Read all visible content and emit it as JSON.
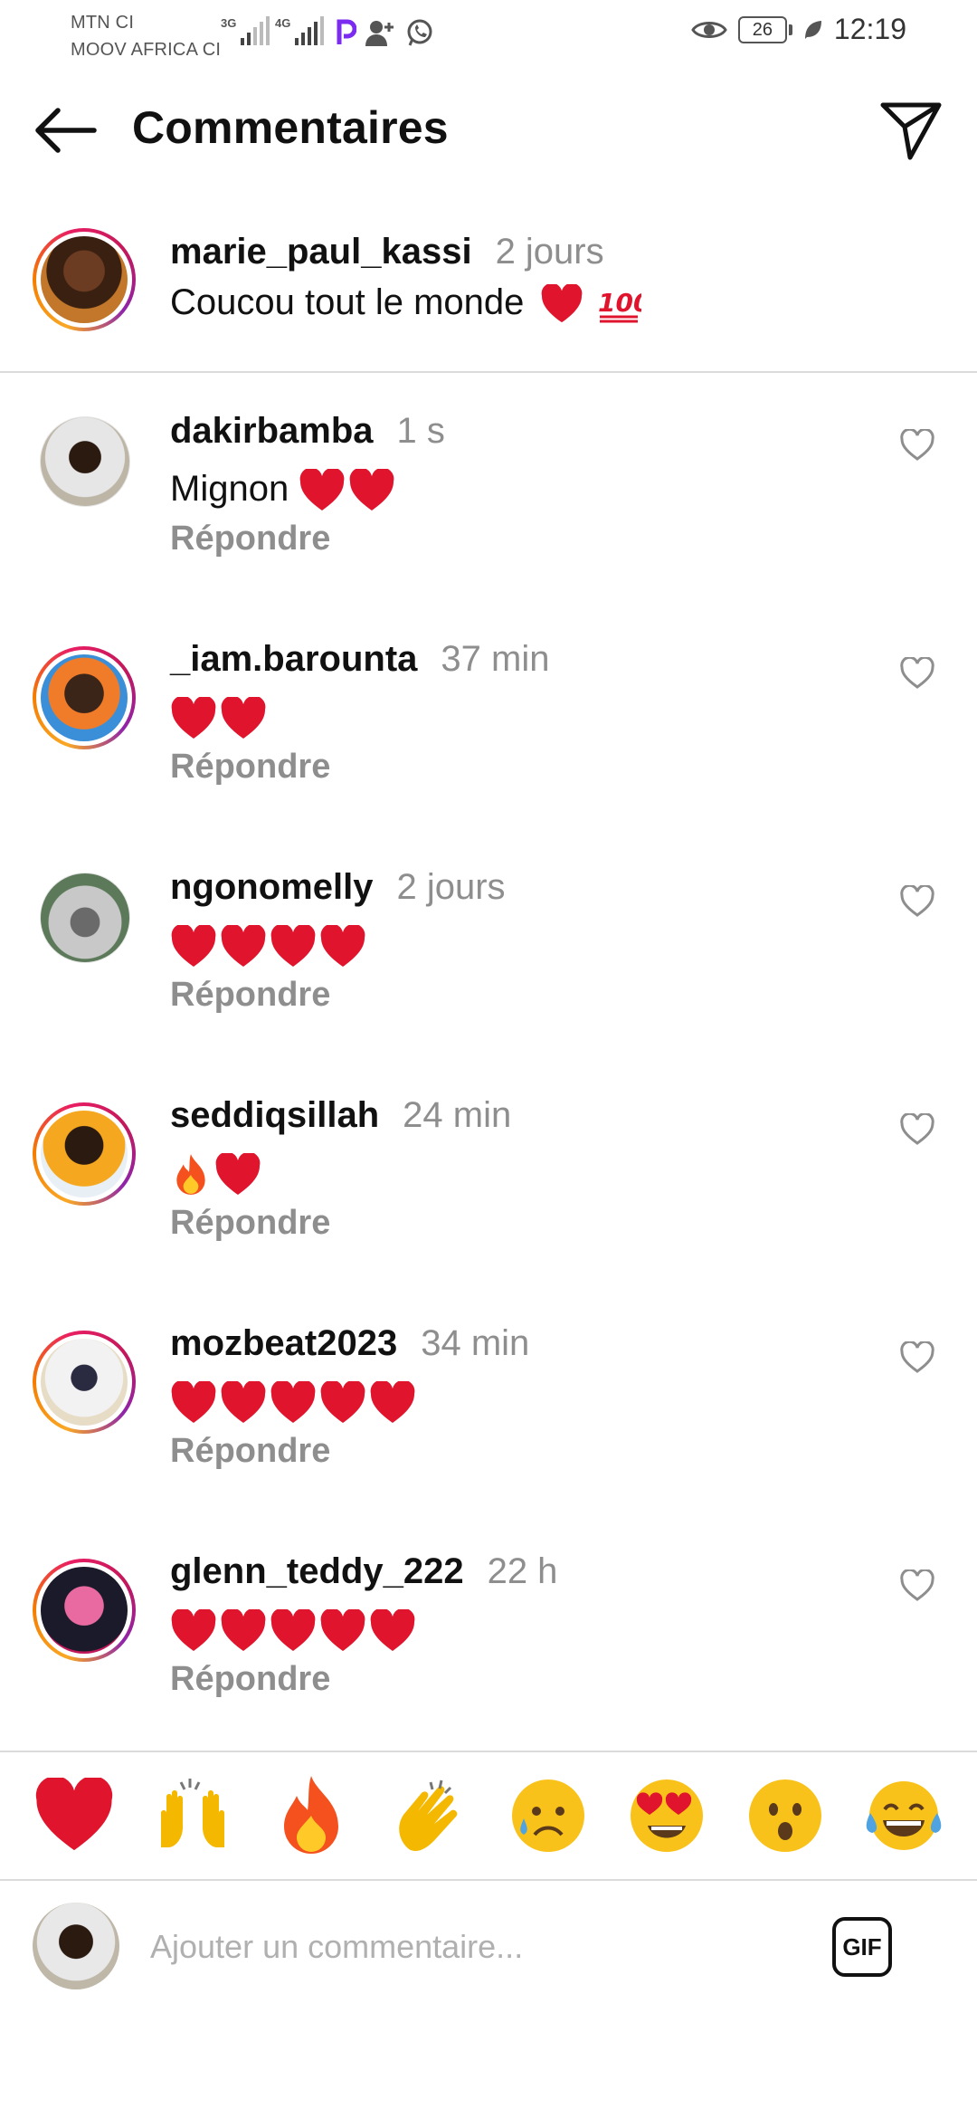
{
  "status_bar": {
    "carrier_1": "MTN CI",
    "carrier_2": "MOOV AFRICA CI",
    "net_1": "3G",
    "net_2": "4G",
    "battery": "26",
    "time": "12:19"
  },
  "header": {
    "title": "Commentaires",
    "back_icon": "arrow-left-icon",
    "share_icon": "send-paper-plane-icon"
  },
  "caption": {
    "username": "marie_paul_kassi",
    "time": "2 jours",
    "text": "Coucou tout le monde ❤️💯",
    "text_plain": "Coucou tout le monde"
  },
  "comments": [
    {
      "username": "dakirbamba",
      "time": "1 s",
      "text": "Mignon",
      "hearts": 2,
      "reply": "Répondre"
    },
    {
      "username": "_iam.barounta",
      "time": "37 min",
      "text": "",
      "hearts": 2,
      "reply": "Répondre"
    },
    {
      "username": "ngonomelly",
      "time": "2 jours",
      "text": "",
      "hearts": 4,
      "reply": "Répondre"
    },
    {
      "username": "seddiqsillah",
      "time": "24 min",
      "text": "",
      "fire": 1,
      "hearts": 1,
      "reply": "Répondre"
    },
    {
      "username": "mozbeat2023",
      "time": "34 min",
      "text": "",
      "hearts": 5,
      "reply": "Répondre"
    },
    {
      "username": "glenn_teddy_222",
      "time": "22 h",
      "text": "",
      "hearts": 5,
      "reply": "Répondre"
    }
  ],
  "reactions": [
    "red-heart",
    "raising-hands",
    "fire",
    "clapping-hands",
    "sad-face",
    "heart-eyes-face",
    "surprised-face",
    "tears-of-joy-face"
  ],
  "input": {
    "placeholder": "Ajouter un commentaire...",
    "gif_label": "GIF"
  },
  "colors": {
    "muted": "#8e8e8e",
    "heart": "#e0142c",
    "divider": "#dbdbdb"
  }
}
